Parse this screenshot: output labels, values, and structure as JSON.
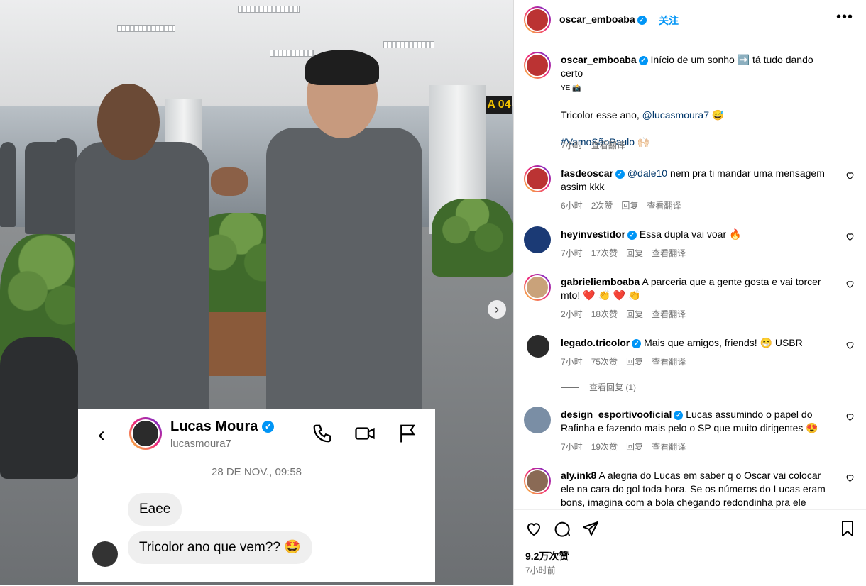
{
  "photo": {
    "gate_sign": "A 04",
    "dm": {
      "name": "Lucas Moura",
      "username": "lucasmoura7",
      "date": "28 DE NOV., 09:58",
      "messages": [
        "Eaee",
        "Tricolor ano que vem?? 🤩"
      ]
    }
  },
  "header": {
    "username": "oscar_emboaba",
    "follow_label": "关注",
    "more_label": "•••"
  },
  "caption": {
    "username": "oscar_emboaba",
    "line1": "Início de um sonho ➡️ tá tudo dando certo",
    "line1b": "YE 📸",
    "line2_prefix": "Tricolor esse ano, ",
    "line2_mention": "@lucasmoura7",
    "line2_suffix": " 😅",
    "hashtag": "#VamoSãoPaulo 🙌🏻",
    "time": "7小时",
    "translate": "查看翻译"
  },
  "comments": [
    {
      "username": "fasdeoscar",
      "verified": true,
      "mention": "@dale10",
      "text": " nem pra ti mandar uma mensagem assim kkk",
      "time": "6小时",
      "likes": "2次赞",
      "reply": "回复",
      "translate": "查看翻译"
    },
    {
      "username": "heyinvestidor",
      "verified": true,
      "mention": "",
      "text": "Essa dupla vai voar 🔥",
      "time": "7小时",
      "likes": "17次赞",
      "reply": "回复",
      "translate": "查看翻译"
    },
    {
      "username": "gabrieliemboaba",
      "verified": false,
      "mention": "",
      "text": "A parceria que a gente gosta e vai torcer mto! ❤️ 👏 ❤️ 👏",
      "time": "2小时",
      "likes": "18次赞",
      "reply": "回复",
      "translate": "查看翻译"
    },
    {
      "username": "legado.tricolor",
      "verified": true,
      "mention": "",
      "text": "Mais que amigos, friends! 😁 USBR",
      "time": "7小时",
      "likes": "75次赞",
      "reply": "回复",
      "translate": "查看翻译",
      "view_replies": "查看回复 (1)"
    },
    {
      "username": "design_esportivooficial",
      "verified": true,
      "mention": "",
      "text": "Lucas assumindo o papel do Rafinha e fazendo mais pelo o SP que muito dirigentes 😍",
      "time": "7小时",
      "likes": "19次赞",
      "reply": "回复",
      "translate": "查看翻译"
    },
    {
      "username": "aly.ink8",
      "verified": false,
      "mention": "",
      "text": "A alegria do Lucas em saber q o Oscar vai colocar ele na cara do gol toda hora. Se os números do Lucas eram bons, imagina com a bola chegando redondinha pra ele",
      "time": "",
      "likes": "",
      "reply": "",
      "translate": ""
    }
  ],
  "footer": {
    "likes": "9.2万次赞",
    "time": "7小时前"
  },
  "colors": {
    "link": "#0095f6",
    "mention": "#00376b",
    "muted": "#737373"
  }
}
